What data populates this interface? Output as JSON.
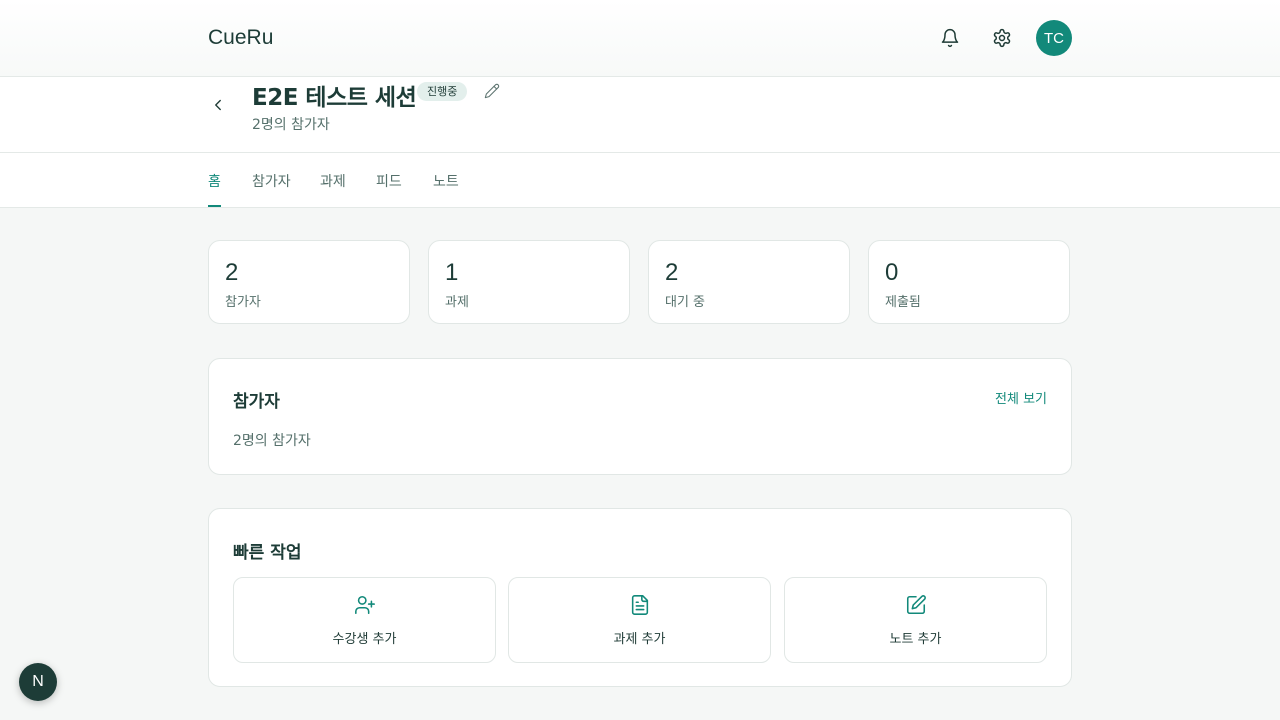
{
  "header": {
    "brand": "CueRu",
    "avatar_initials": "TC",
    "icons": [
      "bell-icon",
      "gear-icon"
    ]
  },
  "session": {
    "title": "E2E 테스트 세션",
    "status_badge": "진행중",
    "subtitle": "2명의 참가자"
  },
  "tabs": [
    {
      "label": "홈",
      "active": true
    },
    {
      "label": "참가자",
      "active": false
    },
    {
      "label": "과제",
      "active": false
    },
    {
      "label": "피드",
      "active": false
    },
    {
      "label": "노트",
      "active": false
    }
  ],
  "stats": [
    {
      "value": "2",
      "label": "참가자"
    },
    {
      "value": "1",
      "label": "과제"
    },
    {
      "value": "2",
      "label": "대기 중"
    },
    {
      "value": "0",
      "label": "제출됨"
    }
  ],
  "participants_card": {
    "title": "참가자",
    "view_all": "전체 보기",
    "summary": "2명의 참가자"
  },
  "quick_actions": {
    "title": "빠른 작업",
    "items": [
      {
        "label": "수강생 추가",
        "icon": "user-plus-icon"
      },
      {
        "label": "과제 추가",
        "icon": "file-icon"
      },
      {
        "label": "노트 추가",
        "icon": "edit-icon"
      }
    ]
  },
  "dev_badge": "N",
  "colors": {
    "accent": "#12897a",
    "text": "#1d3c37",
    "muted": "#55706b",
    "background": "#f5f7f6"
  }
}
